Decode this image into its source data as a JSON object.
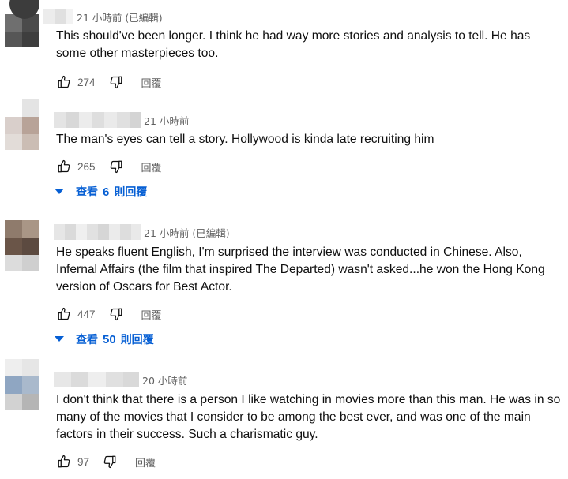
{
  "comments": [
    {
      "timestamp": "21 小時前 (已編輯)",
      "text": "This should've been longer. I think he had way more stories and analysis to tell. He has some other masterpieces too.",
      "likes": "274",
      "reply_label": "回覆",
      "avatar_colors": [
        "#ffffff",
        "#e8e8e8",
        "#6f6f6f",
        "#4b4b4b",
        "#565656",
        "#3e3e3e"
      ],
      "author_blur_colors": [
        "#e9e9e9",
        "#dcdcdc",
        "#f0f0f0"
      ]
    },
    {
      "author_partial": "M l  K    l   ",
      "timestamp": "21 小時前",
      "text": "The man's eyes can tell a story. Hollywood is kinda late recruiting him",
      "likes": "265",
      "reply_label": "回覆",
      "avatar_colors": [
        "#ffffff",
        "#e4e4e4",
        "#d9cfcb",
        "#b8a398",
        "#e2dcd8",
        "#cbbdb4"
      ],
      "author_blur_colors": [
        "#e4e4e4",
        "#d8d8d8",
        "#ececec",
        "#dedede",
        "#eaeaea",
        "#e0e0e0",
        "#d4d4d4"
      ],
      "view_replies": {
        "prefix": "查看",
        "count": "6",
        "suffix": "則回覆"
      }
    },
    {
      "timestamp": "21 小時前 (已編輯)",
      "text": "He speaks fluent English, I'm surprised the interview was conducted in Chinese. Also, Infernal Affairs (the film that inspired The Departed) wasn't asked...he won the Hong Kong version of Oscars for Best Actor.",
      "likes": "447",
      "reply_label": "回覆",
      "avatar_colors": [
        "#8f7b6c",
        "#a99686",
        "#6a5548",
        "#5c4a40",
        "#dcdcdc",
        "#cfcfcf"
      ],
      "author_blur_colors": [
        "#e6e6e6",
        "#dadada",
        "#efefef",
        "#e1e1e1",
        "#d6d6d6",
        "#ebebeb",
        "#dddddd",
        "#e9e9e9"
      ],
      "view_replies": {
        "prefix": "查看",
        "count": "50",
        "suffix": "則回覆"
      }
    },
    {
      "timestamp": "20 小時前",
      "text": "I don't think that there is a person I like watching in movies more than this man. He was in so many of the movies that I consider to be among the best ever, and was one of the main factors in their success. Such a charismatic guy.",
      "likes": "97",
      "reply_label": "回覆",
      "avatar_colors": [
        "#eeeeee",
        "#e6e6e6",
        "#8fa6c2",
        "#a9b9cc",
        "#d2d2d2",
        "#b5b5b5"
      ],
      "author_blur_colors": [
        "#e7e7e7",
        "#dbdbdb",
        "#eeeeee",
        "#e0e0e0",
        "#d9d9d9"
      ]
    }
  ],
  "icons": {
    "like": "thumbs-up-icon",
    "dislike": "thumbs-down-icon",
    "expand": "caret-down-icon"
  },
  "colors": {
    "link_blue": "#065fd4",
    "secondary_text": "#606060",
    "primary_text": "#0f0f0f"
  }
}
